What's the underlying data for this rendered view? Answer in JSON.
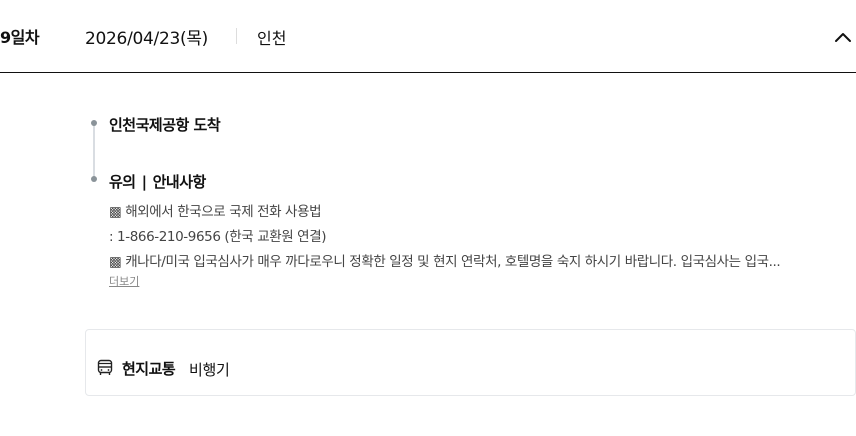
{
  "day": {
    "label": "9일차",
    "date": "2026/04/23(목)",
    "city": "인천"
  },
  "icons": {
    "collapse": "chevron-up-icon",
    "timeline": "timeline-dot-icon",
    "transport": "bus-icon"
  },
  "colors": {
    "text": "#111111",
    "muted": "#444444",
    "dot": "#8a9399",
    "line": "#d9dde2",
    "border": "#e6e8eb"
  },
  "itinerary": {
    "stop": "인천국제공항 도착",
    "notice": {
      "label": "유의",
      "separator": "|",
      "title": "안내사항",
      "lines": [
        "▩ 해외에서 한국으로 국제 전화 사용법",
        ": 1-866-210-9656 (한국 교환원 연결)",
        "▩ 캐나다/미국 입국심사가 매우 까다로우니 정확한 일정 및 현지 연락처, 호텔명을 숙지 하시기 바랍니다. 입국심사는 입국..."
      ],
      "more": "더보기"
    }
  },
  "transport": {
    "label": "현지교통",
    "value": "비행기"
  }
}
